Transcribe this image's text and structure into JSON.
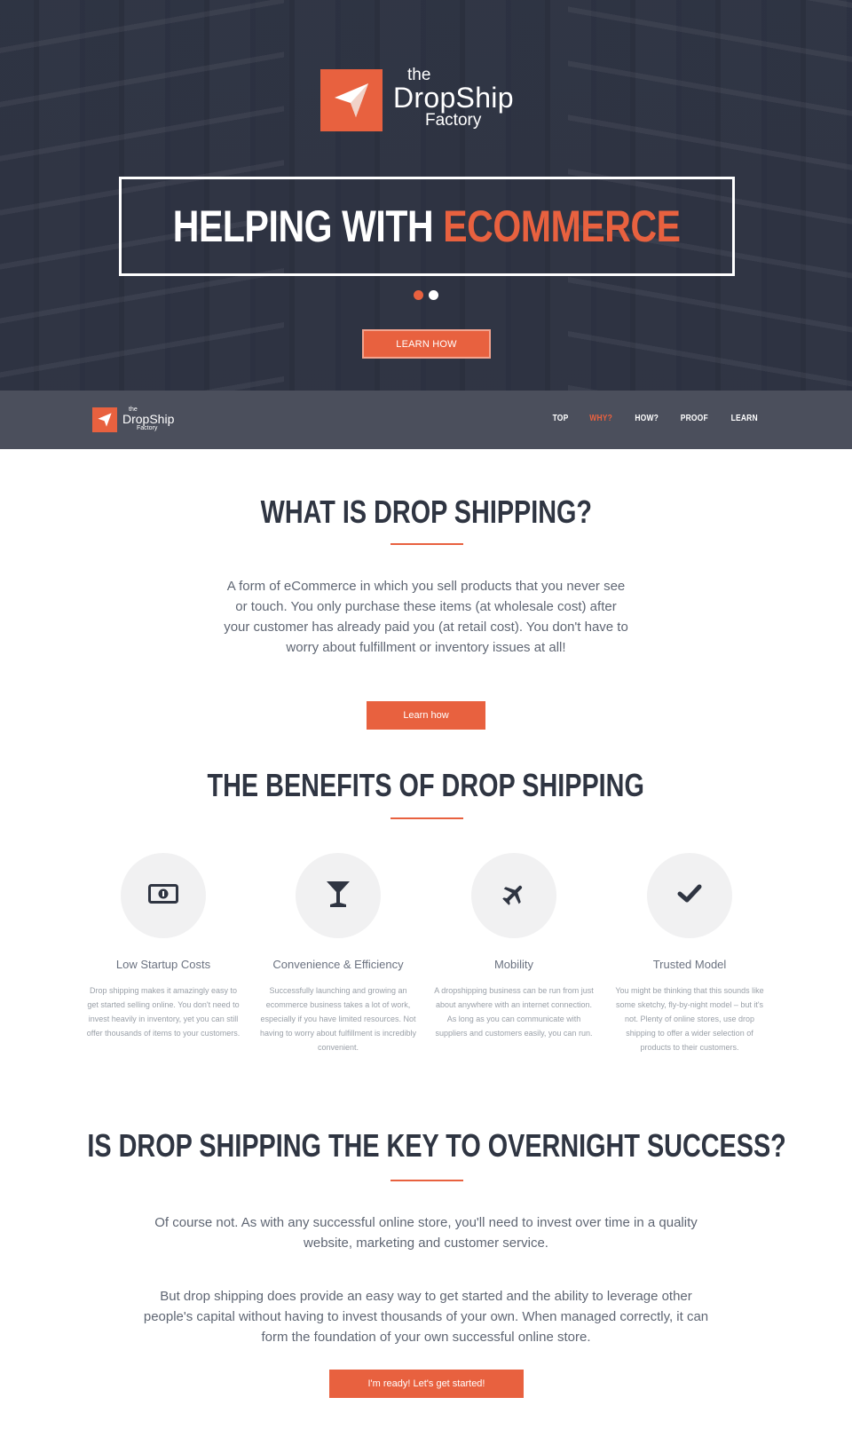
{
  "brand": {
    "the": "the",
    "drop": "DropShip",
    "factory": "Factory"
  },
  "hero": {
    "headline_white": "HELPING WITH",
    "headline_accent": "ECOMMERCE",
    "button": "LEARN HOW",
    "slides": 2,
    "active_slide": 1
  },
  "nav": {
    "items": [
      {
        "label": "TOP",
        "active": false
      },
      {
        "label": "WHY?",
        "active": true
      },
      {
        "label": "HOW?",
        "active": false
      },
      {
        "label": "PROOF",
        "active": false
      },
      {
        "label": "LEARN",
        "active": false
      }
    ]
  },
  "what": {
    "title": "WHAT IS DROP SHIPPING?",
    "text": "A form of eCommerce in which you sell products that you never see or touch. You only purchase these items (at wholesale cost) after your customer has already paid you (at retail cost). You don't have to worry about fulfillment or inventory issues at all!",
    "button": "Learn how"
  },
  "benefits": {
    "title": "THE BENEFITS OF DROP SHIPPING",
    "items": [
      {
        "icon": "money-icon",
        "title": "Low Startup Costs",
        "text": "Drop shipping makes it amazingly easy to get started selling online. You don't need to invest heavily in inventory, yet you can still offer thousands of items to your customers."
      },
      {
        "icon": "cocktail-icon",
        "title": "Convenience & Efficiency",
        "text": "Successfully launching and growing an ecommerce business takes a lot of work, especially if you have limited resources. Not having to worry about fulfillment is incredibly convenient."
      },
      {
        "icon": "airplane-icon",
        "title": "Mobility",
        "text": "A dropshipping business can be run from just about anywhere with an internet connection. As long as you can communicate with suppliers and customers easily, you can run."
      },
      {
        "icon": "checkmark-icon",
        "title": "Trusted Model",
        "text": "You might be thinking that this sounds like some sketchy, fly-by-night model – but it's not. Plenty of online stores, use drop shipping to offer a wider selection of products to their customers."
      }
    ]
  },
  "overnight": {
    "title": "IS DROP SHIPPING THE KEY TO OVERNIGHT SUCCESS?",
    "text1": "Of course not. As with any successful online store, you'll need to invest over time in a quality website, marketing and customer service.",
    "text2": "But drop shipping does provide an easy way to get started and the ability to leverage other people's capital without having to invest thousands of your own. When managed correctly, it can form the foundation of your own successful online store.",
    "button": "I'm ready! Let's get started!"
  },
  "colors": {
    "accent": "#e8613f",
    "dark": "#2f3542",
    "navbar": "#4b4f5c"
  }
}
